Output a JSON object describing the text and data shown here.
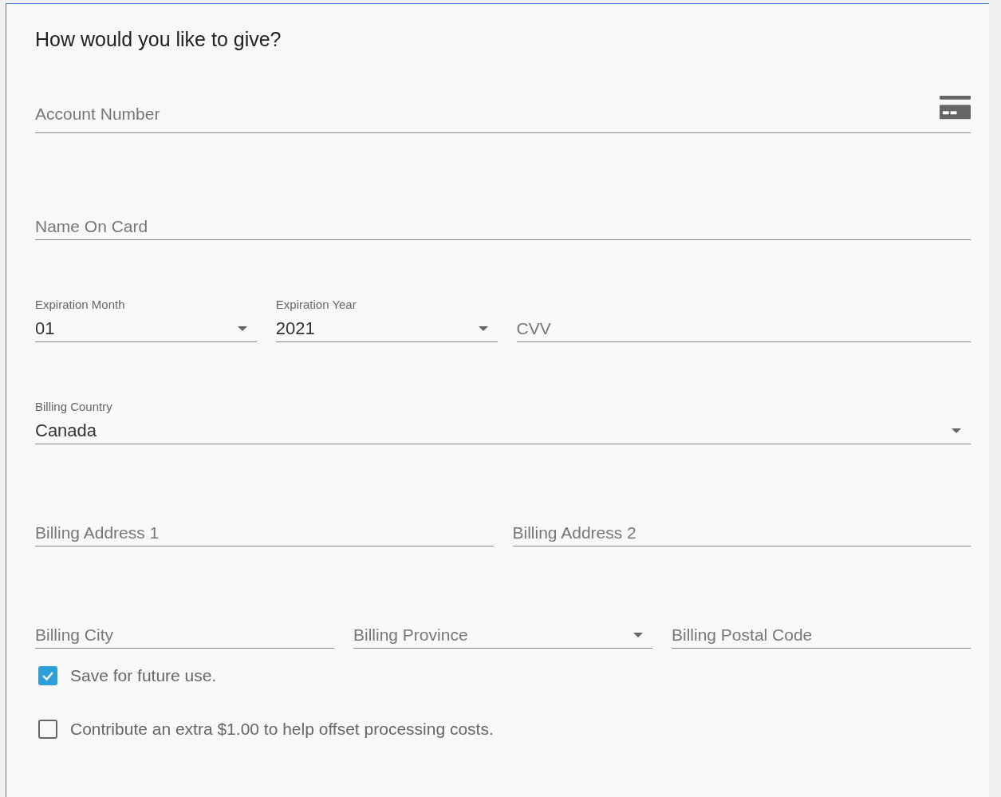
{
  "heading": "How would you like to give?",
  "rows": [
    {
      "fields": [
        {
          "kind": "card",
          "placeholder": "Account Number"
        }
      ]
    },
    {
      "fields": [
        {
          "kind": "text",
          "placeholder": "Name On Card"
        }
      ]
    },
    {
      "fields": [
        {
          "kind": "select",
          "label": "Expiration Month",
          "value": "01"
        },
        {
          "kind": "select",
          "label": "Expiration Year",
          "value": "2021"
        },
        {
          "kind": "text",
          "placeholder": "CVV"
        }
      ]
    },
    {
      "fields": [
        {
          "kind": "select",
          "label": "Billing Country",
          "value": "Canada"
        }
      ]
    },
    {
      "fields": [
        {
          "kind": "text",
          "placeholder": "Billing Address 1"
        },
        {
          "kind": "text",
          "placeholder": "Billing Address 2"
        }
      ]
    },
    {
      "fields": [
        {
          "kind": "text",
          "placeholder": "Billing City"
        },
        {
          "kind": "select",
          "placeholder": "Billing Province"
        },
        {
          "kind": "text",
          "placeholder": "Billing Postal Code"
        }
      ]
    }
  ],
  "options": [
    {
      "label": "Save for future use.",
      "checked": true
    },
    {
      "label": "Contribute an extra $1.00 to help offset processing costs.",
      "checked": false
    }
  ]
}
